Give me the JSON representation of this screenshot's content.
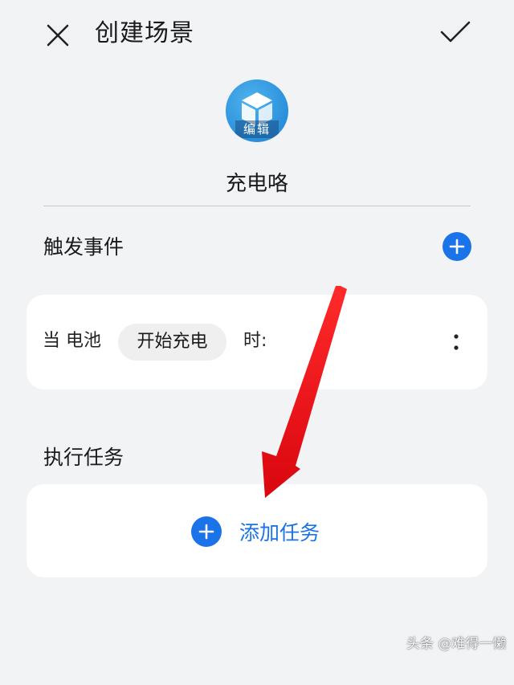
{
  "header": {
    "title": "创建场景",
    "close_icon": "close-icon",
    "confirm_icon": "checkmark-icon"
  },
  "scene": {
    "icon": "cube-scene-icon",
    "edit_label": "编辑",
    "name": "充电咯"
  },
  "trigger_section": {
    "title": "触发事件",
    "add_icon": "plus-icon",
    "condition": {
      "prefix": "当 电池",
      "state": "开始充电",
      "suffix": "时:"
    },
    "more_icon": "more-vertical-icon"
  },
  "task_section": {
    "title": "执行任务",
    "add_label": "添加任务",
    "add_icon": "plus-icon"
  },
  "watermark": "头条 @难得一懒",
  "colors": {
    "accent": "#1a73e8",
    "background": "#f1f3f5",
    "card": "#ffffff",
    "arrow": "#e8101a"
  }
}
